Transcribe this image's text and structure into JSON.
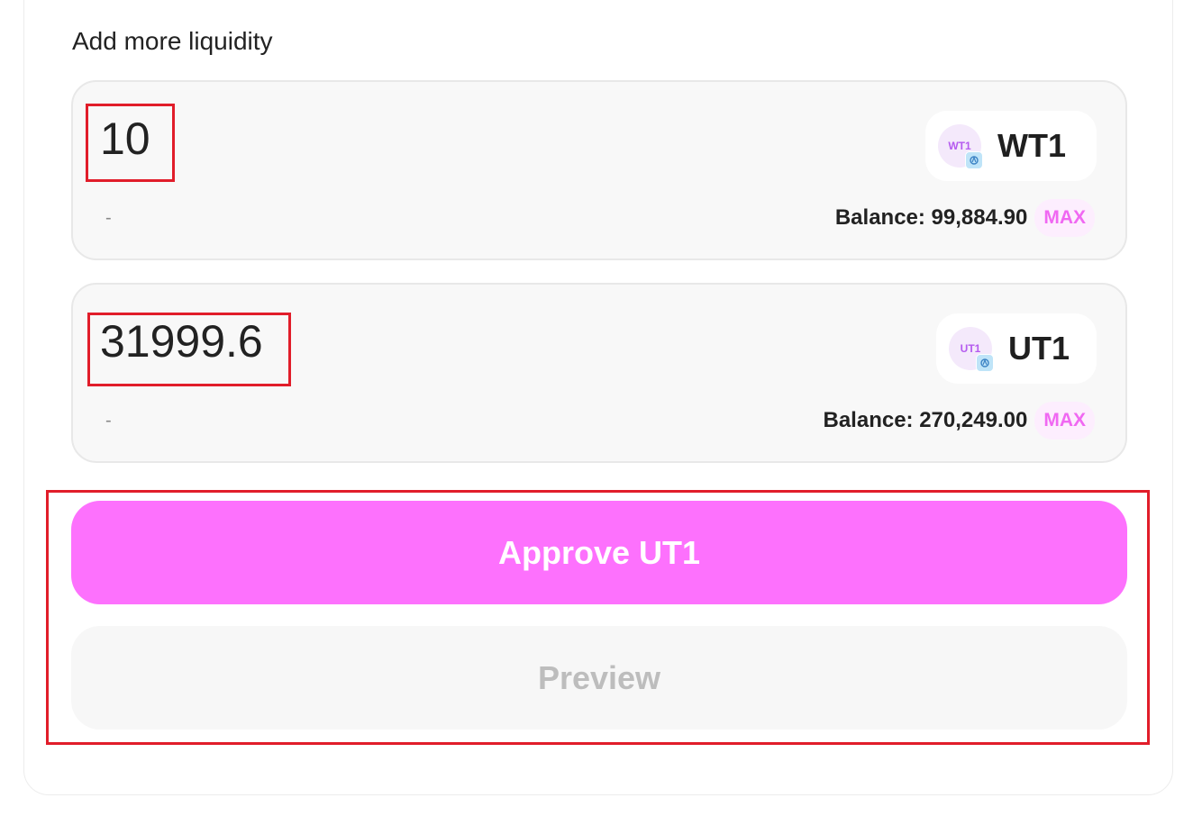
{
  "section": {
    "title": "Add more liquidity"
  },
  "tokens": [
    {
      "amount": "10",
      "usd_value": "-",
      "symbol": "WT1",
      "logo_text": "WT1",
      "balance": "Balance: 99,884.90",
      "max_label": "MAX"
    },
    {
      "amount": "31999.6",
      "usd_value": "-",
      "symbol": "UT1",
      "logo_text": "UT1",
      "balance": "Balance: 270,249.00",
      "max_label": "MAX"
    }
  ],
  "actions": {
    "approve_label": "Approve UT1",
    "preview_label": "Preview"
  },
  "colors": {
    "accent": "#fd71fd",
    "max_text": "#f068f2",
    "highlight": "#e11d2a"
  }
}
